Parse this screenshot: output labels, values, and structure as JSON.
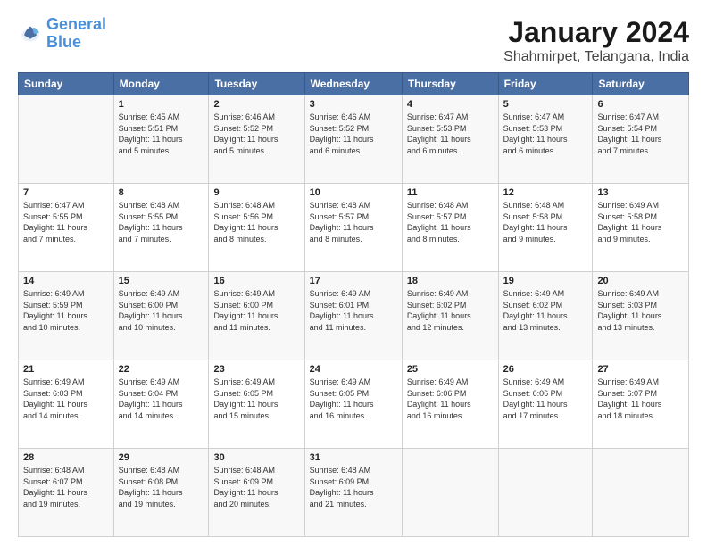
{
  "header": {
    "logo_general": "General",
    "logo_blue": "Blue",
    "title": "January 2024",
    "subtitle": "Shahmirpet, Telangana, India"
  },
  "days_of_week": [
    "Sunday",
    "Monday",
    "Tuesday",
    "Wednesday",
    "Thursday",
    "Friday",
    "Saturday"
  ],
  "weeks": [
    [
      {
        "day": "",
        "info": ""
      },
      {
        "day": "1",
        "info": "Sunrise: 6:45 AM\nSunset: 5:51 PM\nDaylight: 11 hours\nand 5 minutes."
      },
      {
        "day": "2",
        "info": "Sunrise: 6:46 AM\nSunset: 5:52 PM\nDaylight: 11 hours\nand 5 minutes."
      },
      {
        "day": "3",
        "info": "Sunrise: 6:46 AM\nSunset: 5:52 PM\nDaylight: 11 hours\nand 6 minutes."
      },
      {
        "day": "4",
        "info": "Sunrise: 6:47 AM\nSunset: 5:53 PM\nDaylight: 11 hours\nand 6 minutes."
      },
      {
        "day": "5",
        "info": "Sunrise: 6:47 AM\nSunset: 5:53 PM\nDaylight: 11 hours\nand 6 minutes."
      },
      {
        "day": "6",
        "info": "Sunrise: 6:47 AM\nSunset: 5:54 PM\nDaylight: 11 hours\nand 7 minutes."
      }
    ],
    [
      {
        "day": "7",
        "info": "Sunrise: 6:47 AM\nSunset: 5:55 PM\nDaylight: 11 hours\nand 7 minutes."
      },
      {
        "day": "8",
        "info": "Sunrise: 6:48 AM\nSunset: 5:55 PM\nDaylight: 11 hours\nand 7 minutes."
      },
      {
        "day": "9",
        "info": "Sunrise: 6:48 AM\nSunset: 5:56 PM\nDaylight: 11 hours\nand 8 minutes."
      },
      {
        "day": "10",
        "info": "Sunrise: 6:48 AM\nSunset: 5:57 PM\nDaylight: 11 hours\nand 8 minutes."
      },
      {
        "day": "11",
        "info": "Sunrise: 6:48 AM\nSunset: 5:57 PM\nDaylight: 11 hours\nand 8 minutes."
      },
      {
        "day": "12",
        "info": "Sunrise: 6:48 AM\nSunset: 5:58 PM\nDaylight: 11 hours\nand 9 minutes."
      },
      {
        "day": "13",
        "info": "Sunrise: 6:49 AM\nSunset: 5:58 PM\nDaylight: 11 hours\nand 9 minutes."
      }
    ],
    [
      {
        "day": "14",
        "info": "Sunrise: 6:49 AM\nSunset: 5:59 PM\nDaylight: 11 hours\nand 10 minutes."
      },
      {
        "day": "15",
        "info": "Sunrise: 6:49 AM\nSunset: 6:00 PM\nDaylight: 11 hours\nand 10 minutes."
      },
      {
        "day": "16",
        "info": "Sunrise: 6:49 AM\nSunset: 6:00 PM\nDaylight: 11 hours\nand 11 minutes."
      },
      {
        "day": "17",
        "info": "Sunrise: 6:49 AM\nSunset: 6:01 PM\nDaylight: 11 hours\nand 11 minutes."
      },
      {
        "day": "18",
        "info": "Sunrise: 6:49 AM\nSunset: 6:02 PM\nDaylight: 11 hours\nand 12 minutes."
      },
      {
        "day": "19",
        "info": "Sunrise: 6:49 AM\nSunset: 6:02 PM\nDaylight: 11 hours\nand 13 minutes."
      },
      {
        "day": "20",
        "info": "Sunrise: 6:49 AM\nSunset: 6:03 PM\nDaylight: 11 hours\nand 13 minutes."
      }
    ],
    [
      {
        "day": "21",
        "info": "Sunrise: 6:49 AM\nSunset: 6:03 PM\nDaylight: 11 hours\nand 14 minutes."
      },
      {
        "day": "22",
        "info": "Sunrise: 6:49 AM\nSunset: 6:04 PM\nDaylight: 11 hours\nand 14 minutes."
      },
      {
        "day": "23",
        "info": "Sunrise: 6:49 AM\nSunset: 6:05 PM\nDaylight: 11 hours\nand 15 minutes."
      },
      {
        "day": "24",
        "info": "Sunrise: 6:49 AM\nSunset: 6:05 PM\nDaylight: 11 hours\nand 16 minutes."
      },
      {
        "day": "25",
        "info": "Sunrise: 6:49 AM\nSunset: 6:06 PM\nDaylight: 11 hours\nand 16 minutes."
      },
      {
        "day": "26",
        "info": "Sunrise: 6:49 AM\nSunset: 6:06 PM\nDaylight: 11 hours\nand 17 minutes."
      },
      {
        "day": "27",
        "info": "Sunrise: 6:49 AM\nSunset: 6:07 PM\nDaylight: 11 hours\nand 18 minutes."
      }
    ],
    [
      {
        "day": "28",
        "info": "Sunrise: 6:48 AM\nSunset: 6:07 PM\nDaylight: 11 hours\nand 19 minutes."
      },
      {
        "day": "29",
        "info": "Sunrise: 6:48 AM\nSunset: 6:08 PM\nDaylight: 11 hours\nand 19 minutes."
      },
      {
        "day": "30",
        "info": "Sunrise: 6:48 AM\nSunset: 6:09 PM\nDaylight: 11 hours\nand 20 minutes."
      },
      {
        "day": "31",
        "info": "Sunrise: 6:48 AM\nSunset: 6:09 PM\nDaylight: 11 hours\nand 21 minutes."
      },
      {
        "day": "",
        "info": ""
      },
      {
        "day": "",
        "info": ""
      },
      {
        "day": "",
        "info": ""
      }
    ]
  ]
}
